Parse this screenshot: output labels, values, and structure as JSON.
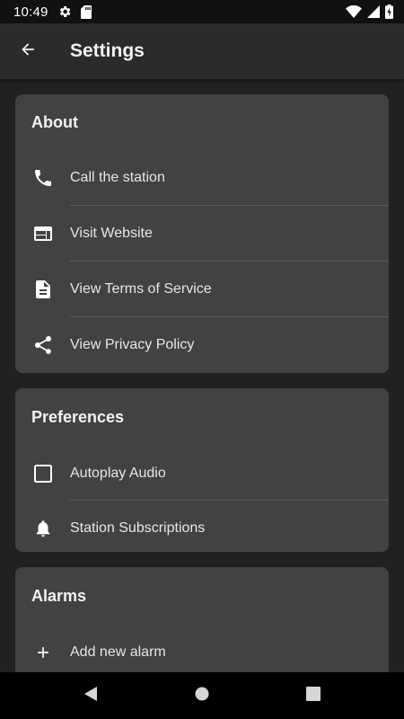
{
  "status_bar": {
    "time": "10:49"
  },
  "app_bar": {
    "title": "Settings"
  },
  "about": {
    "title": "About",
    "items": [
      {
        "label": "Call the station",
        "icon": "phone-icon"
      },
      {
        "label": "Visit Website",
        "icon": "web-icon"
      },
      {
        "label": "View Terms of Service",
        "icon": "document-icon"
      },
      {
        "label": "View Privacy Policy",
        "icon": "share-icon"
      }
    ]
  },
  "preferences": {
    "title": "Preferences",
    "items": [
      {
        "label": "Autoplay Audio",
        "icon": "checkbox-icon",
        "checked": false
      },
      {
        "label": "Station Subscriptions",
        "icon": "bell-icon"
      }
    ]
  },
  "alarms": {
    "title": "Alarms",
    "items": [
      {
        "label": "Add new alarm",
        "icon": "plus-icon"
      }
    ]
  },
  "colors": {
    "background": "#212121",
    "card": "#424242",
    "app_bar": "#2b2b2b",
    "text": "#e6e6e6"
  }
}
